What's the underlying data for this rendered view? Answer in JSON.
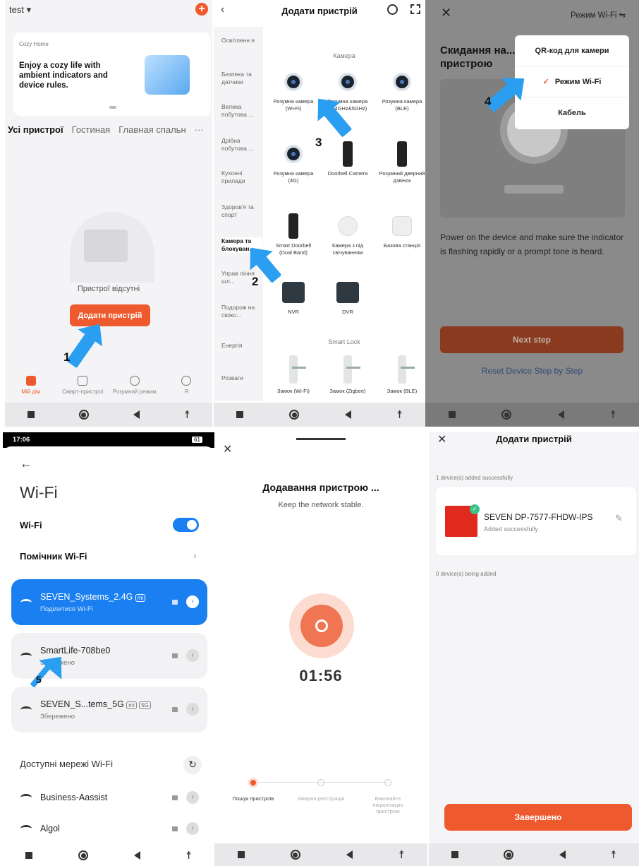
{
  "p1": {
    "home_name": "test",
    "card_label": "Cozy Home",
    "card_text": "Enjoy a cozy life with ambient indicators and device rules.",
    "tabs": [
      "Усі пристрої",
      "Гостиная",
      "Главная спальн"
    ],
    "more": "···",
    "empty": "Пристрої відсутні",
    "add_btn": "Додати пристрій",
    "tabbar": [
      "Мій дім",
      "Смарт-пристрої",
      "Розумний режим",
      "Я"
    ],
    "step": "1",
    "accent": "#ee5a2d"
  },
  "p2": {
    "title": "Додати пристрій",
    "categories": [
      "Освітленн я",
      "Безпека та датчики",
      "Велика побутова ...",
      "Дрібна побутова ...",
      "Кухонні прилади",
      "Здоров'я та спорт",
      "Камера та блокуван...",
      "Управ ління шл...",
      "Подорож на свіжо...",
      "Енергія",
      "Розваги",
      "..."
    ],
    "section_camera": "Камера",
    "section_lock": "Smart Lock",
    "devices": [
      "Розумна камера (Wi-Fi)",
      "Розумна камера (2.4GHz&5GHz)",
      "Розумна камера (BLE)",
      "Розумна камера (4G)",
      "Doorbell Camera",
      "Розумний дверний дзвінок",
      "Smart Doorbell (Dual Band)",
      "Камера з під свічуванням",
      "Базова станція",
      "NVR",
      "DVR"
    ],
    "locks": [
      "Замок (Wi-Fi)",
      "Замок (Zigbee)",
      "Замок (BLE)"
    ],
    "step_2": "2",
    "step_3": "3"
  },
  "p3": {
    "mode": "Режим Wi-Fi ⇋",
    "title": "Скидання на... пристрою",
    "menu": [
      "QR-код для камери",
      "Режим Wi-Fi",
      "Кабель"
    ],
    "desc": "Power on the device and make sure the indicator is flashing rapidly or a prompt tone is heard.",
    "next": "Next step",
    "reset": "Reset Device Step by Step",
    "step": "4"
  },
  "p4": {
    "time": "17:06",
    "battery": "61",
    "title": "Wi-Fi",
    "wifi_label": "Wi-Fi",
    "helper": "Помічник Wi-Fi",
    "net1": "SEVEN_Systems_2.4G",
    "net1_sub": "Поділитися Wi-Fi",
    "net2": "SmartLife-708be0",
    "net2_sub": "Збережено",
    "net3": "SEVEN_S...tems_5G",
    "net3_sub": "Збережено",
    "tag_mi": "mi",
    "tag_5g": "5G",
    "available": "Доступні мережі Wi-Fi",
    "net4": "Business-Aassist",
    "net5": "Algol",
    "step": "5"
  },
  "p5": {
    "title": "Додавання пристрою ...",
    "sub": "Keep the network stable.",
    "timer": "01:56",
    "steps": [
      "Пошук пристроїв",
      "Хмарна реєстрація",
      "Виконайте ініціалізацію пристрою"
    ]
  },
  "p6": {
    "title": "Додати пристрій",
    "added": "1 device(s) added successfully",
    "device": "SEVEN DP-7577-FHDW-IPS",
    "device_sub": "Added successfully",
    "adding": "0 device(s) being added",
    "finish": "Завершено"
  }
}
